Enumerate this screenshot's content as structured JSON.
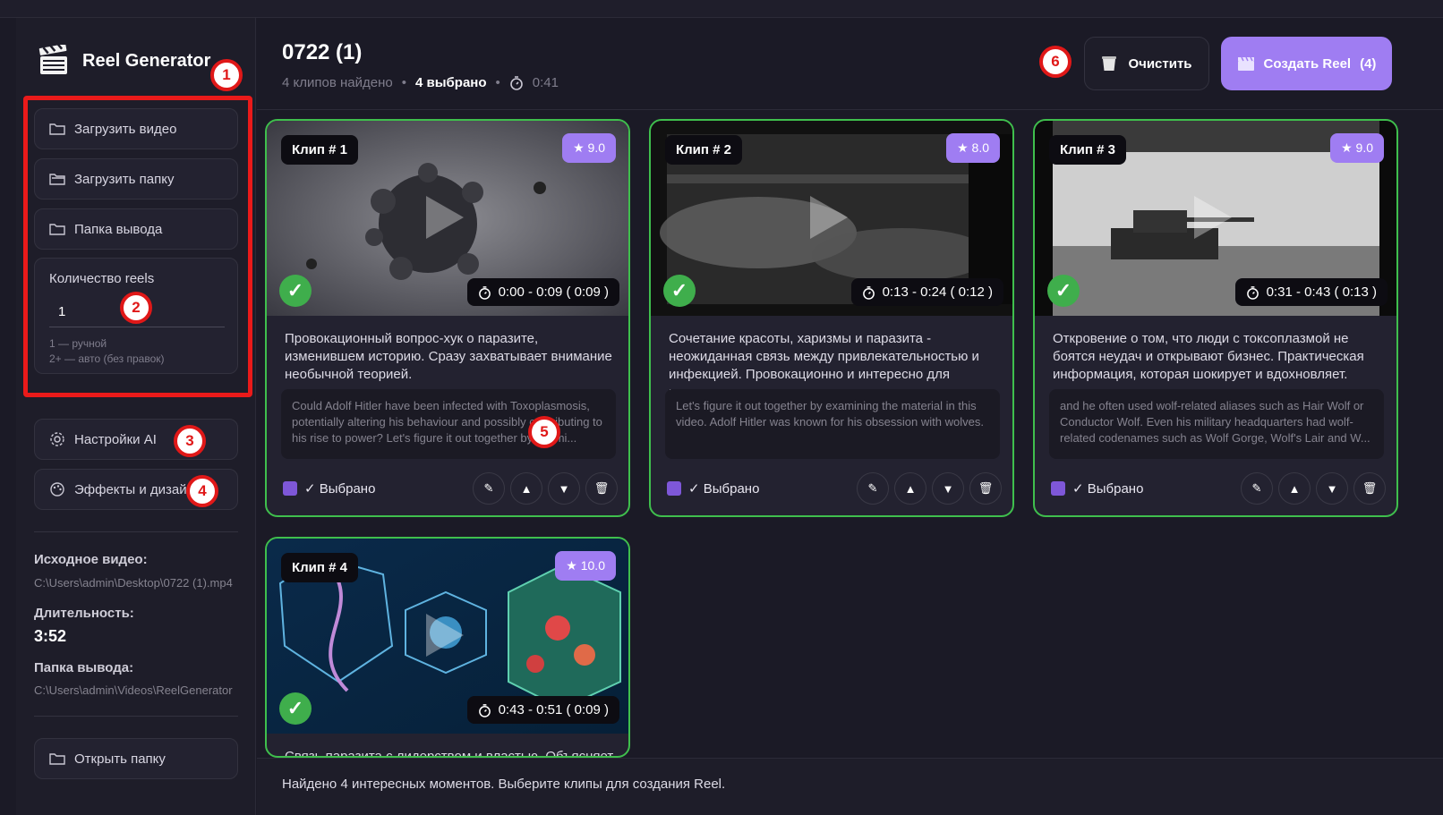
{
  "app": {
    "name": "Reel Generator"
  },
  "sidebar": {
    "upload_video": "Загрузить видео",
    "upload_folder": "Загрузить папку",
    "output_folder": "Папка вывода",
    "reels_count_label": "Количество reels",
    "reels_count_value": "1",
    "hint_manual": "1 — ручной",
    "hint_auto": "2+ — авто (без правок)",
    "ai_settings": "Настройки AI",
    "effects": "Эффекты и дизайн",
    "source_label": "Исходное видео:",
    "source_path": "C:\\Users\\admin\\Desktop\\0722 (1).mp4",
    "duration_label": "Длительность:",
    "duration_value": "3:52",
    "output_label": "Папка вывода:",
    "output_path": "C:\\Users\\admin\\Videos\\ReelGenerator",
    "open_folder": "Открыть папку"
  },
  "annotations": [
    "1",
    "2",
    "3",
    "4",
    "5",
    "6"
  ],
  "header": {
    "title": "0722 (1)",
    "clips_found": "4 клипов найдено",
    "selected": "4 выбрано",
    "total_time": "0:41",
    "clear_label": "Очистить",
    "create_label": "Создать Reel",
    "create_count": "(4)"
  },
  "clips": [
    {
      "tag": "Клип # 1",
      "score": "★ 9.0",
      "time": "0:00 - 0:09  ( 0:09 )",
      "desc": "Провокационный вопрос-хук о паразите, изменившем историю. Сразу захватывает внимание необычной теорией.",
      "quote": "Could Adolf Hitler have been infected with Toxoplasmosis, potentially altering his behaviour and possibly contributing to his rise to power? Let's figure it out together by exami...",
      "selected": "✓ Выбрано"
    },
    {
      "tag": "Клип # 2",
      "score": "★ 8.0",
      "time": "0:13 - 0:24  ( 0:12 )",
      "desc": "Сочетание красоты, харизмы и паразита - неожиданная связь между привлекательностью и инфекцией. Провокационно и интересно для широк...",
      "quote": "Let's figure it out together by examining the material in this video. Adolf Hitler was known for his obsession with wolves.",
      "selected": "✓ Выбрано"
    },
    {
      "tag": "Клип # 3",
      "score": "★ 9.0",
      "time": "0:31 - 0:43  ( 0:13 )",
      "desc": "Откровение о том, что люди с токсоплазмой не боятся неудач и открывают бизнес. Практическая информация, которая шокирует и вдохновляет.",
      "quote": "and he often used wolf-related aliases such as Hair Wolf or Conductor Wolf. Even his military headquarters had wolf-related codenames such as Wolf Gorge, Wolf's Lair and W...",
      "selected": "✓ Выбрано"
    },
    {
      "tag": "Клип # 4",
      "score": "★ 10.0",
      "time": "0:43 - 0:51  ( 0:09 )",
      "desc": "Связь паразита с лидерством и властью. Объясняет",
      "quote": "",
      "selected": "✓ Выбрано"
    }
  ],
  "status": {
    "text": "Найдено 4 интересных моментов. Выберите клипы для создания Reel."
  }
}
